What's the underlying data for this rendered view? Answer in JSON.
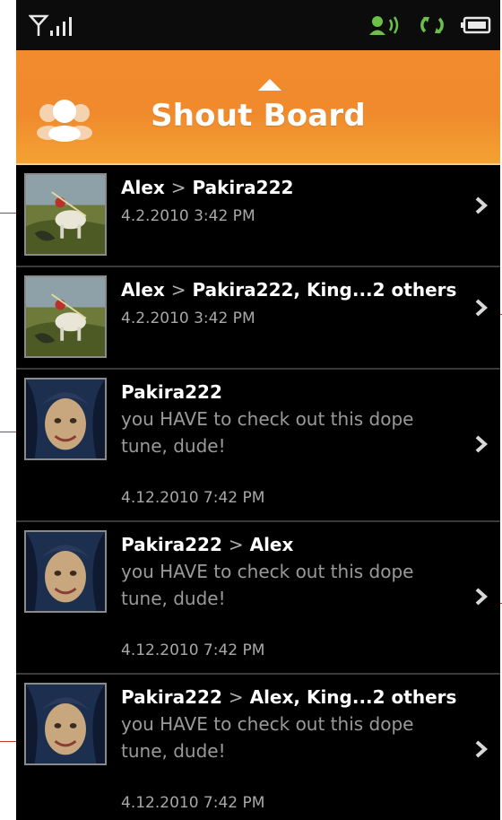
{
  "header": {
    "title": "Shout Board"
  },
  "colors": {
    "accent": "#f08a2c",
    "background": "#000000",
    "divider": "#3a3a3a"
  },
  "statusbar": {
    "icons": [
      "signal-icon",
      "speaker-icon",
      "sync-icon",
      "battery-icon"
    ]
  },
  "shouts": [
    {
      "sender": "Alex",
      "separator": ">",
      "recipients": "Pakira222",
      "message": "",
      "time": "4.2.2010 3:42 PM",
      "avatar": "knight-painting"
    },
    {
      "sender": "Alex",
      "separator": ">",
      "recipients": "Pakira222, King...2 others",
      "message": "",
      "time": "4.2.2010 3:42 PM",
      "avatar": "knight-painting"
    },
    {
      "sender": "Pakira222",
      "separator": "",
      "recipients": "",
      "message": "you HAVE to check out this dope tune, dude!",
      "time": "4.12.2010 7:42 PM",
      "avatar": "face-portrait"
    },
    {
      "sender": "Pakira222",
      "separator": ">",
      "recipients": "Alex",
      "message": "you HAVE to check out this dope tune, dude!",
      "time": "4.12.2010 7:42 PM",
      "avatar": "face-portrait"
    },
    {
      "sender": "Pakira222",
      "separator": ">",
      "recipients": "Alex, King...2 others",
      "message": "you HAVE to check out this dope tune, dude!",
      "time": "4.12.2010 7:42 PM",
      "avatar": "face-portrait"
    }
  ]
}
